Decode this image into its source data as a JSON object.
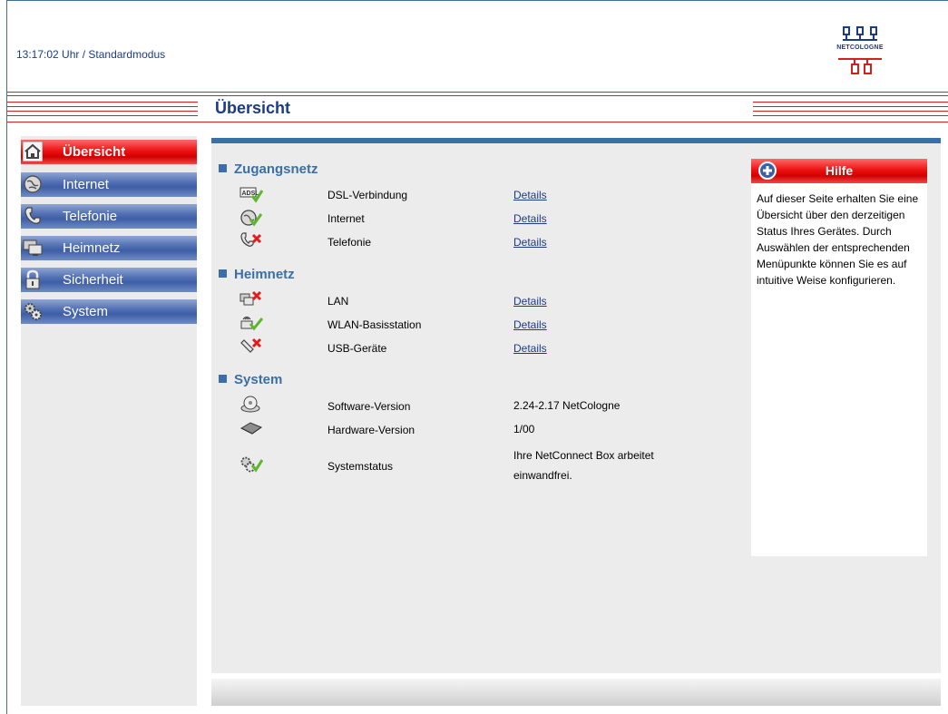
{
  "header": {
    "status_time": "13:17:02 Uhr",
    "status_mode": "/ Standardmodus",
    "logo_text": "NETCOLOGNE"
  },
  "page_title": "Übersicht",
  "sidebar": {
    "items": [
      {
        "label": "Übersicht",
        "icon": "home-icon",
        "active": true
      },
      {
        "label": "Internet",
        "icon": "globe-icon",
        "active": false
      },
      {
        "label": "Telefonie",
        "icon": "phone-icon",
        "active": false
      },
      {
        "label": "Heimnetz",
        "icon": "computer-icon",
        "active": false
      },
      {
        "label": "Sicherheit",
        "icon": "lock-icon",
        "active": false
      },
      {
        "label": "System",
        "icon": "gears-icon",
        "active": false
      }
    ]
  },
  "sections": {
    "zugangsnetz": {
      "title": "Zugangsnetz",
      "rows": [
        {
          "label": "DSL-Verbindung",
          "link": "Details",
          "status": "ok"
        },
        {
          "label": "Internet",
          "link": "Details",
          "status": "ok"
        },
        {
          "label": "Telefonie",
          "link": "Details",
          "status": "error"
        }
      ]
    },
    "heimnetz": {
      "title": "Heimnetz",
      "rows": [
        {
          "label": "LAN",
          "link": "Details",
          "status": "error"
        },
        {
          "label": "WLAN-Basisstation",
          "link": "Details",
          "status": "ok"
        },
        {
          "label": "USB-Geräte",
          "link": "Details",
          "status": "error"
        }
      ]
    },
    "system": {
      "title": "System",
      "rows": [
        {
          "label": "Software-Version",
          "value": "2.24-2.17 NetCologne"
        },
        {
          "label": "Hardware-Version",
          "value": "1/00"
        },
        {
          "label": "Systemstatus",
          "value_line1": "Ihre NetConnect Box arbeitet",
          "value_line2": "einwandfrei."
        }
      ]
    }
  },
  "help": {
    "title": "Hilfe",
    "text": "Auf dieser Seite erhalten Sie eine Übersicht über den derzeitigen Status Ihres Gerätes. Durch Auswählen der entsprechenden Menüpunkte können Sie es auf intuitive Weise konfigurieren."
  },
  "colors": {
    "accent_blue": "#3b6fa6",
    "accent_red": "#d31f1f",
    "ok_green": "#5cb82a",
    "error_red": "#e11c1c"
  }
}
